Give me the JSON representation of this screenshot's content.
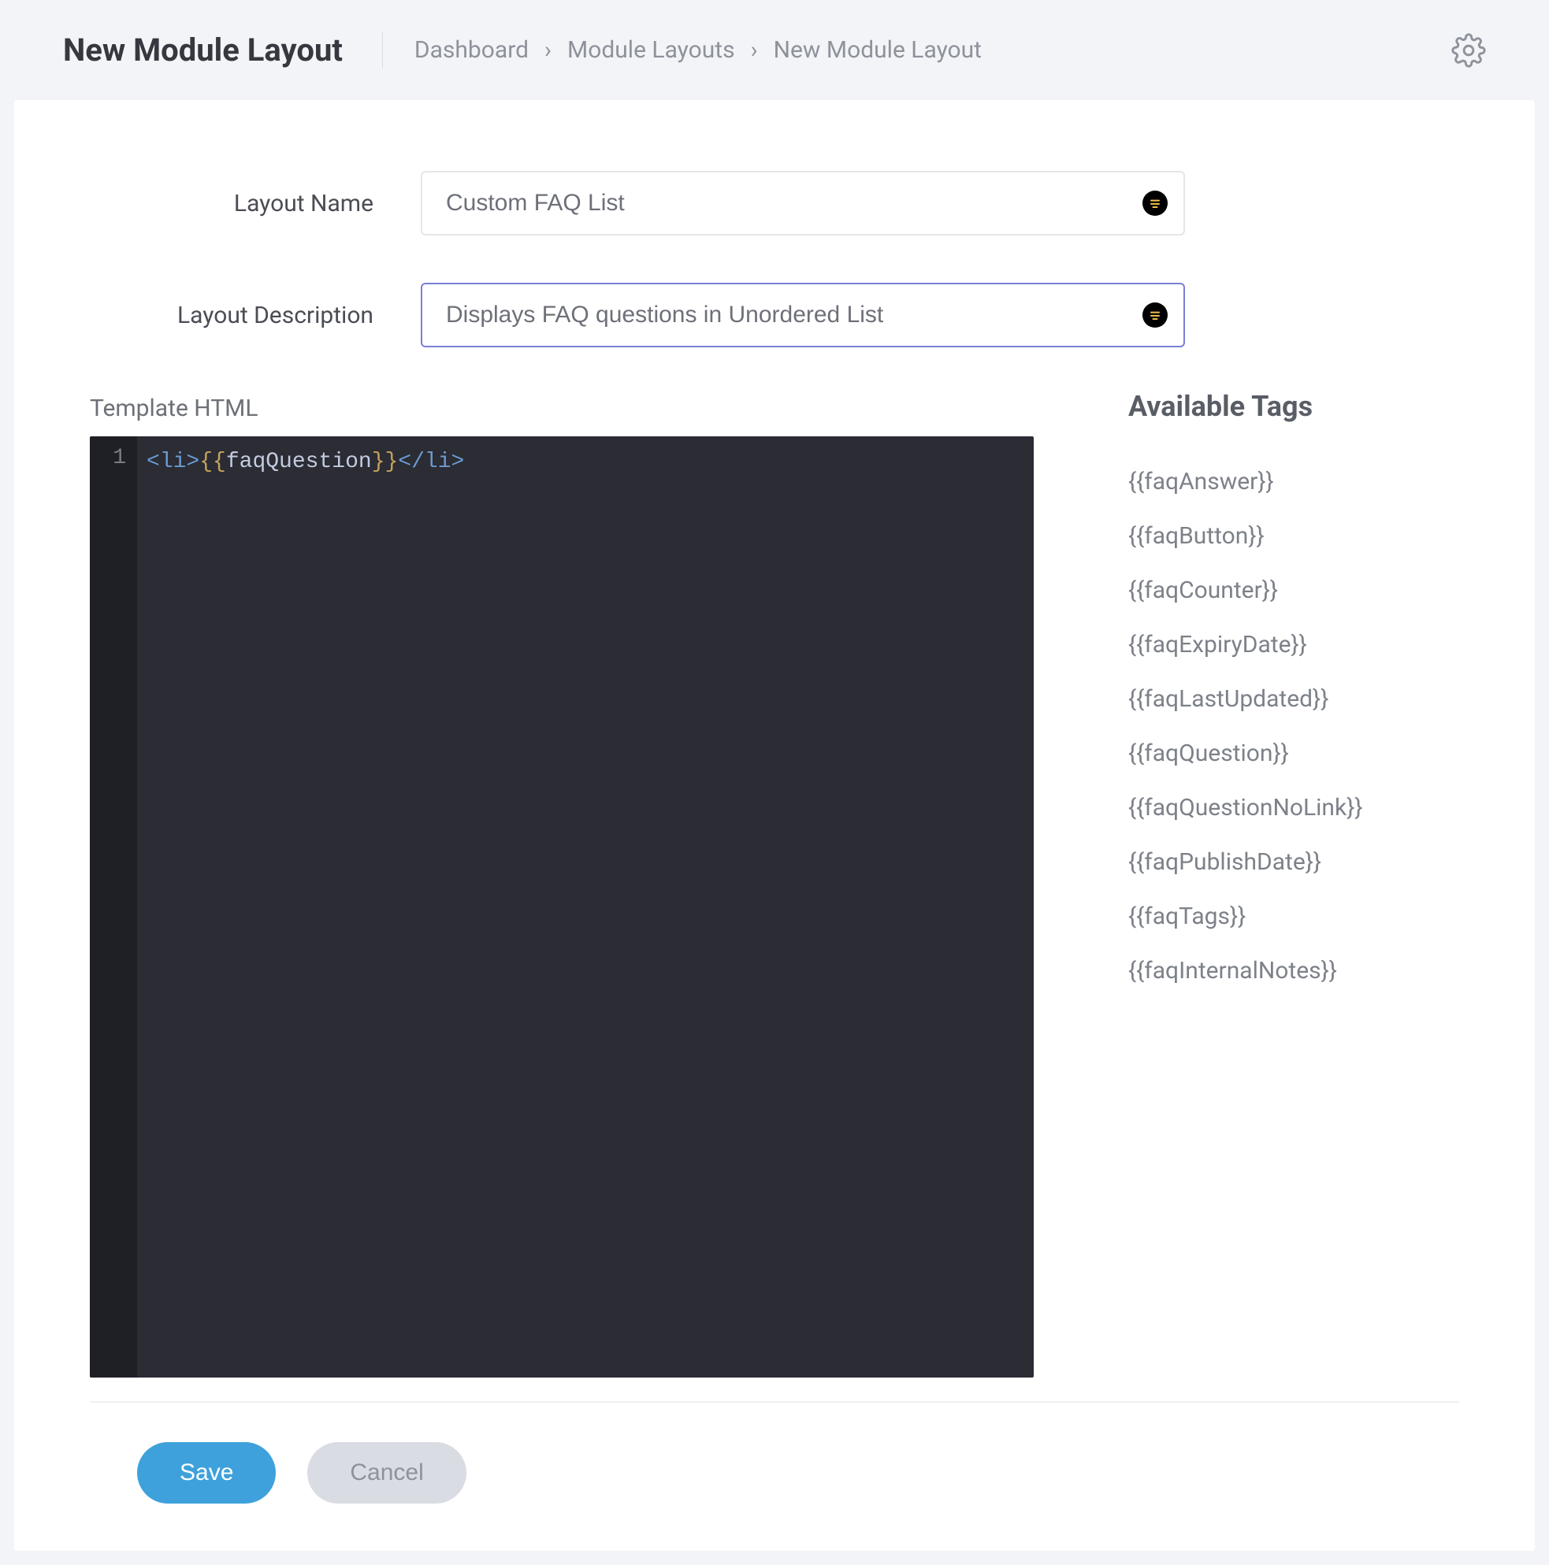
{
  "header": {
    "title": "New Module Layout",
    "breadcrumb": [
      "Dashboard",
      "Module Layouts",
      "New Module Layout"
    ]
  },
  "form": {
    "name_label": "Layout Name",
    "name_value": "Custom FAQ List",
    "desc_label": "Layout Description",
    "desc_value": "Displays FAQ questions in Unordered List",
    "template_label": "Template HTML"
  },
  "editor": {
    "line_no": "1",
    "tag_open_lt": "<",
    "tag_open_name": "li",
    "tag_open_gt": ">",
    "brace_open": "{{",
    "var": "faqQuestion",
    "brace_close": "}}",
    "tag_close_lt": "</",
    "tag_close_name": "li",
    "tag_close_gt": ">"
  },
  "tags": {
    "title": "Available Tags",
    "items": [
      "{{faqAnswer}}",
      "{{faqButton}}",
      "{{faqCounter}}",
      "{{faqExpiryDate}}",
      "{{faqLastUpdated}}",
      "{{faqQuestion}}",
      "{{faqQuestionNoLink}}",
      "{{faqPublishDate}}",
      "{{faqTags}}",
      "{{faqInternalNotes}}"
    ]
  },
  "actions": {
    "save": "Save",
    "cancel": "Cancel"
  }
}
